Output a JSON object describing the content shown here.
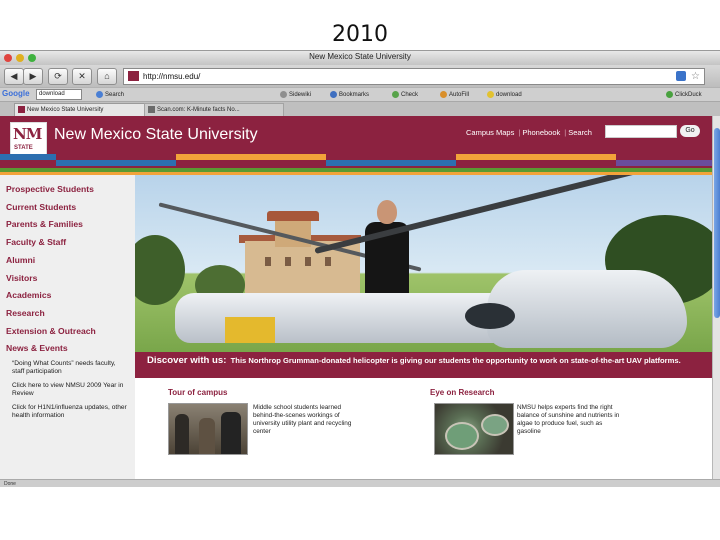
{
  "slide_title": "2010",
  "window": {
    "title": "New Mexico State University"
  },
  "navbar": {
    "back": "◀",
    "forward": "▶",
    "reload": "⟳",
    "stop": "✕",
    "home": "⌂",
    "url": "http://nmsu.edu/"
  },
  "google_toolbar": {
    "logo": "Google",
    "search_value": "download",
    "items": [
      "Search",
      "Sidewiki",
      "Bookmarks",
      "Check",
      "AutoFill",
      "download"
    ],
    "right_item": "ClickDuck"
  },
  "tabs": [
    {
      "label": "New Mexico State University"
    },
    {
      "label": "Scan.com: K-Minute facts No..."
    }
  ],
  "header": {
    "logo_letters": "NM",
    "logo_state": "STATE",
    "site_title": "New Mexico State University",
    "links": [
      "Campus Maps",
      "Phonebook",
      "Search"
    ],
    "go_label": "Go"
  },
  "stripe_colors": [
    "#8c2240",
    "#2c6fb0",
    "#f2a33a",
    "#5a9a32",
    "#6a4c9c"
  ],
  "sidebar": {
    "items": [
      "Prospective Students",
      "Current Students",
      "Parents & Families",
      "Faculty & Staff",
      "Alumni",
      "Visitors",
      "Academics",
      "Research",
      "Extension & Outreach",
      "News & Events"
    ],
    "notes": [
      "“Doing What Counts” needs faculty, staff participation",
      "Click here to view NMSU 2009 Year in Review",
      "Click for H1N1/influenza updates, other health information"
    ]
  },
  "discover": {
    "label": "Discover with us:",
    "text": "This Northrop Grumman-donated helicopter is giving our students the opportunity to work on state-of-the-art UAV platforms."
  },
  "tour": {
    "title": "Tour of campus",
    "blurb": "Middle school students learned behind-the-scenes workings of university utility plant and recycling center"
  },
  "research": {
    "title": "Eye on Research",
    "blurb": "NMSU helps experts find the right balance of sunshine and nutrients in algae to produce fuel, such as gasoline"
  },
  "status": "Done"
}
